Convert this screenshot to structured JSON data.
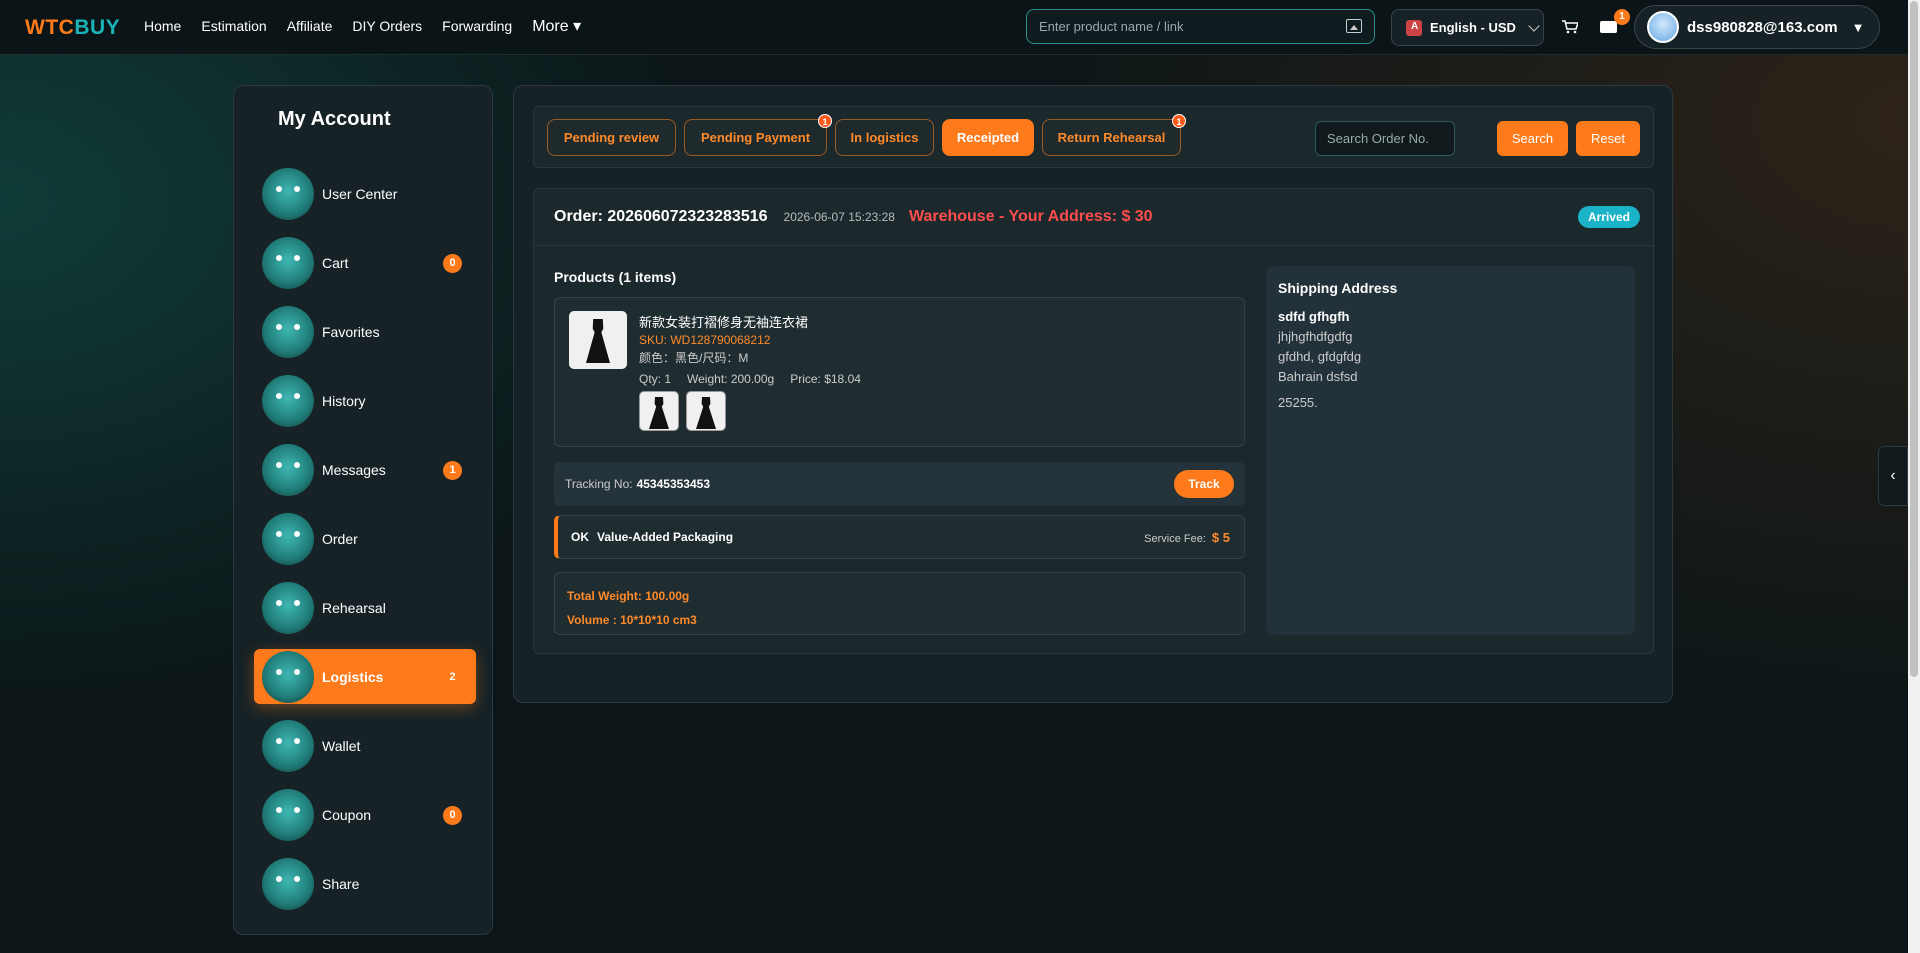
{
  "brand": {
    "logo_left": "WTC",
    "logo_right": "BUY"
  },
  "nav": {
    "items": [
      "Home",
      "Estimation",
      "Affiliate",
      "DIY Orders",
      "Forwarding"
    ],
    "more": "More ▾"
  },
  "search": {
    "placeholder": "Enter product name / link"
  },
  "lang": {
    "label": "English - USD"
  },
  "header": {
    "mail_badge": "1",
    "user_email": "dss980828@163.com"
  },
  "sidebar": {
    "title": "My Account",
    "items": [
      {
        "label": "User Center",
        "count": ""
      },
      {
        "label": "Cart",
        "count": "0"
      },
      {
        "label": "Favorites",
        "count": ""
      },
      {
        "label": "History",
        "count": ""
      },
      {
        "label": "Messages",
        "count": "1"
      },
      {
        "label": "Order",
        "count": ""
      },
      {
        "label": "Rehearsal",
        "count": ""
      },
      {
        "label": "Logistics",
        "count": "2"
      },
      {
        "label": "Wallet",
        "count": ""
      },
      {
        "label": "Coupon",
        "count": "0"
      },
      {
        "label": "Share",
        "count": ""
      }
    ]
  },
  "tabs": [
    {
      "label": "Pending review",
      "badge": ""
    },
    {
      "label": "Pending Payment",
      "badge": "1"
    },
    {
      "label": "In logistics",
      "badge": ""
    },
    {
      "label": "Receipted",
      "badge": ""
    },
    {
      "label": "Return Rehearsal",
      "badge": "1"
    }
  ],
  "order_search": {
    "placeholder": "Search Order No.",
    "search_label": "Search",
    "reset_label": "Reset"
  },
  "order": {
    "number": "Order: 202606072323283516",
    "date": "2026-06-07 15:23:28",
    "route": "Warehouse - Your Address: $ 30",
    "status": "Arrived",
    "products_title": "Products (1 items)",
    "product": {
      "name": "新款女装打褶修身无袖连衣裙",
      "sku": "SKU: WD128790068212",
      "attrs": "颜色：黑色/尺码：M",
      "qty": "Qty: 1",
      "weight": "Weight: 200.00g",
      "price": "Price: $18.04"
    },
    "tracking_label": "Tracking No:",
    "tracking_no": "45345353453",
    "track_label": "Track",
    "service_ok": "OK",
    "service_name": "Value-Added Packaging",
    "service_fee_label": "Service Fee:",
    "service_fee": "$ 5",
    "total_weight": "Total Weight: 100.00g",
    "volume": "Volume : 10*10*10 cm3"
  },
  "shipping": {
    "title": "Shipping Address",
    "name": "sdfd gfhgfh",
    "line1": "jhjhgfhdfgdfg",
    "line2": "gfdhd, gfdgfdg",
    "line3": "Bahrain dsfsd",
    "zip": "25255."
  },
  "colors": {
    "accent": "#ff7a1a",
    "teal": "#1ab3b8",
    "status": "#1ab3c8",
    "alert": "#ff4d4d"
  }
}
